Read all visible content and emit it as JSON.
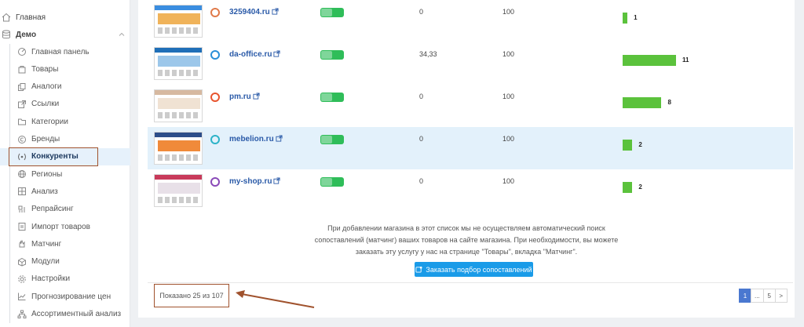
{
  "sidebar": {
    "top_item": "Главная",
    "section": "Демо",
    "items": [
      {
        "label": "Главная панель",
        "icon": "dashboard-icon"
      },
      {
        "label": "Товары",
        "icon": "bag-icon"
      },
      {
        "label": "Аналоги",
        "icon": "copy-icon"
      },
      {
        "label": "Ссылки",
        "icon": "external-link-icon"
      },
      {
        "label": "Категории",
        "icon": "folder-icon"
      },
      {
        "label": "Бренды",
        "icon": "copyright-icon"
      },
      {
        "label": "Конкуренты",
        "icon": "competitors-icon",
        "active": true
      },
      {
        "label": "Регионы",
        "icon": "globe-icon"
      },
      {
        "label": "Анализ",
        "icon": "grid-icon"
      },
      {
        "label": "Репрайсинг",
        "icon": "tag-icon"
      },
      {
        "label": "Импорт товаров",
        "icon": "import-icon"
      },
      {
        "label": "Матчинг",
        "icon": "hand-icon"
      },
      {
        "label": "Модули",
        "icon": "box-icon"
      },
      {
        "label": "Настройки",
        "icon": "gear-icon"
      },
      {
        "label": "Прогнозирование цен",
        "icon": "chart-line-icon"
      },
      {
        "label": "Ассортиментный анализ",
        "icon": "sitemap-icon"
      }
    ]
  },
  "table": {
    "rows": [
      {
        "site": "3259404.ru",
        "value1": "0",
        "value2": "100",
        "count": "1",
        "bar": 1,
        "logo_color": "#e07a4a"
      },
      {
        "site": "da-office.ru",
        "value1": "34,33",
        "value2": "100",
        "count": "11",
        "bar": 11,
        "logo_color": "#2a8fd8"
      },
      {
        "site": "pm.ru",
        "value1": "0",
        "value2": "100",
        "count": "8",
        "bar": 8,
        "logo_color": "#e8542e"
      },
      {
        "site": "mebelion.ru",
        "value1": "0",
        "value2": "100",
        "count": "2",
        "bar": 2,
        "logo_color": "#2db3c8",
        "highlighted": true
      },
      {
        "site": "my-shop.ru",
        "value1": "0",
        "value2": "100",
        "count": "2",
        "bar": 2,
        "logo_color": "#8a4ab8"
      }
    ]
  },
  "note": {
    "line1": "При добавлении магазина в этот список мы не осуществляем автоматический поиск",
    "line2": "сопоставлений (матчинг) ваших товаров на сайте магазина. При необходимости, вы можете",
    "line3": "заказать эту услугу у нас на странице \"Товары\", вкладка \"Матчинг\"."
  },
  "order_button": "Заказать подбор сопоставлений",
  "shown_text": "Показано 25 из 107",
  "pagination": [
    "1",
    "...",
    "5",
    ">"
  ],
  "colors": {
    "accent": "#1a9be8",
    "bar": "#5bc23c",
    "toggle": "#2fbd59",
    "annotation": "#a0522d"
  }
}
